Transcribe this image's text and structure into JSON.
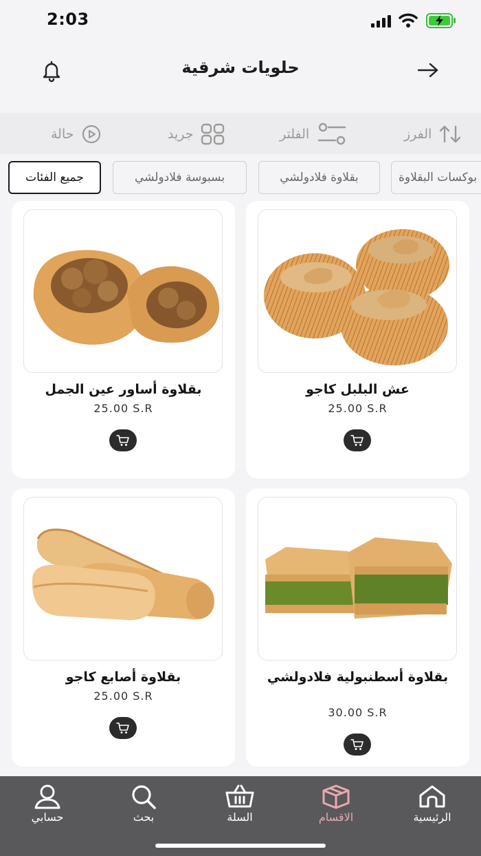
{
  "status_bar": {
    "time": "2:03"
  },
  "header": {
    "title": "حلويات شرقية"
  },
  "toolbar": {
    "sort_label": "الفرز",
    "filter_label": "الفلتر",
    "grid_label": "جريد",
    "status_label": "حالة"
  },
  "categories": {
    "all": "جميع الفئات",
    "chip1": "بسبوسة فلادولشي",
    "chip2": "بقلاوة فلادولشي",
    "chip3": "بوكسات البقلاوة"
  },
  "products": [
    {
      "name": "عش البلبل كاجو",
      "price": "25.00  S.R"
    },
    {
      "name": "بقلاوة أساور عين الجمل",
      "price": "25.00  S.R"
    },
    {
      "name": "بقلاوة أسطنبولية فلادولشي",
      "price": "30.00  S.R"
    },
    {
      "name": "بقلاوة أصابع كاجو",
      "price": "25.00  S.R"
    }
  ],
  "nav": {
    "home": "الرئيسية",
    "categories": "الاقسام",
    "cart": "السلة",
    "search": "بحث",
    "account": "حسابي",
    "active_color": "#e8a9b2"
  }
}
